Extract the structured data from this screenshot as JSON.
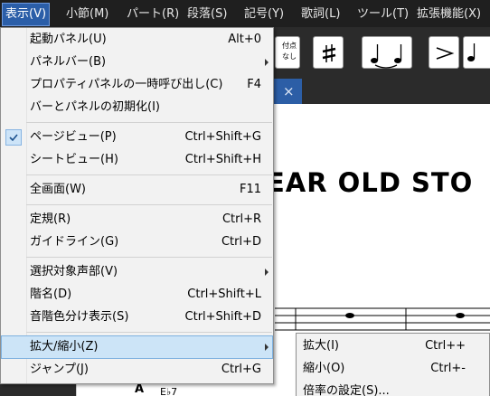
{
  "menubar": {
    "items": [
      "表示(V)",
      "小節(M)",
      "パート(R)",
      "段落(S)",
      "記号(Y)",
      "歌詞(L)",
      "ツール(T)",
      "拡張機能(X)"
    ]
  },
  "toolbar": {
    "no_accidental_label": "付点\nなし",
    "buttons": [
      "no-dot-button",
      "sharp-button",
      "tie-button",
      "accent-button",
      "staccato-button"
    ]
  },
  "tab": {
    "close": "×"
  },
  "score": {
    "title_visible": "EAR OLD STO",
    "chord_fragment": "A",
    "chord_name": "E♭7"
  },
  "view_menu": {
    "items": [
      {
        "label": "起動パネル(U)",
        "shortcut": "Alt+0"
      },
      {
        "label": "パネルバー(B)",
        "submenu": true
      },
      {
        "label": "プロパティパネルの一時呼び出し(C)",
        "shortcut": "F4"
      },
      {
        "label": "バーとパネルの初期化(I)"
      },
      {
        "label": "ページビュー(P)",
        "shortcut": "Ctrl+Shift+G",
        "checked": true
      },
      {
        "label": "シートビュー(H)",
        "shortcut": "Ctrl+Shift+H"
      },
      {
        "label": "全画面(W)",
        "shortcut": "F11"
      },
      {
        "label": "定規(R)",
        "shortcut": "Ctrl+R"
      },
      {
        "label": "ガイドライン(G)",
        "shortcut": "Ctrl+D"
      },
      {
        "label": "選択対象声部(V)",
        "submenu": true
      },
      {
        "label": "階名(D)",
        "shortcut": "Ctrl+Shift+L"
      },
      {
        "label": "音階色分け表示(S)",
        "shortcut": "Ctrl+Shift+D"
      },
      {
        "label": "拡大/縮小(Z)",
        "submenu": true,
        "highlighted": true
      },
      {
        "label": "ジャンプ(J)",
        "shortcut": "Ctrl+G"
      }
    ]
  },
  "zoom_submenu": {
    "items": [
      {
        "label": "拡大(I)",
        "shortcut": "Ctrl++"
      },
      {
        "label": "縮小(O)",
        "shortcut": "Ctrl+-"
      },
      {
        "label": "倍率の設定(S)..."
      }
    ]
  },
  "colors": {
    "menubar_bg": "#1f1f1f",
    "active_menu": "#2b5ea8",
    "menu_bg": "#f2f2f2",
    "highlight": "#cce4f7",
    "tab_active": "#2c5ea6"
  }
}
